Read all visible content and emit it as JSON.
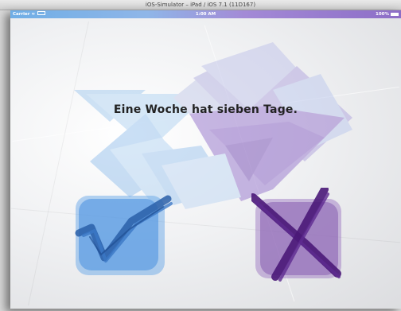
{
  "window": {
    "title": "iOS-Simulator – iPad / iOS 7.1 (11D167)"
  },
  "status_bar": {
    "carrier": "Carrier",
    "time": "1:00 AM",
    "battery": "100%"
  },
  "quiz": {
    "question": "Eine Woche hat sieben Tage."
  },
  "colors": {
    "true_accent": "#3f8de0",
    "false_accent": "#5a2a82"
  },
  "icons": {
    "true_button": "check-mark-icon",
    "false_button": "x-mark-icon"
  }
}
